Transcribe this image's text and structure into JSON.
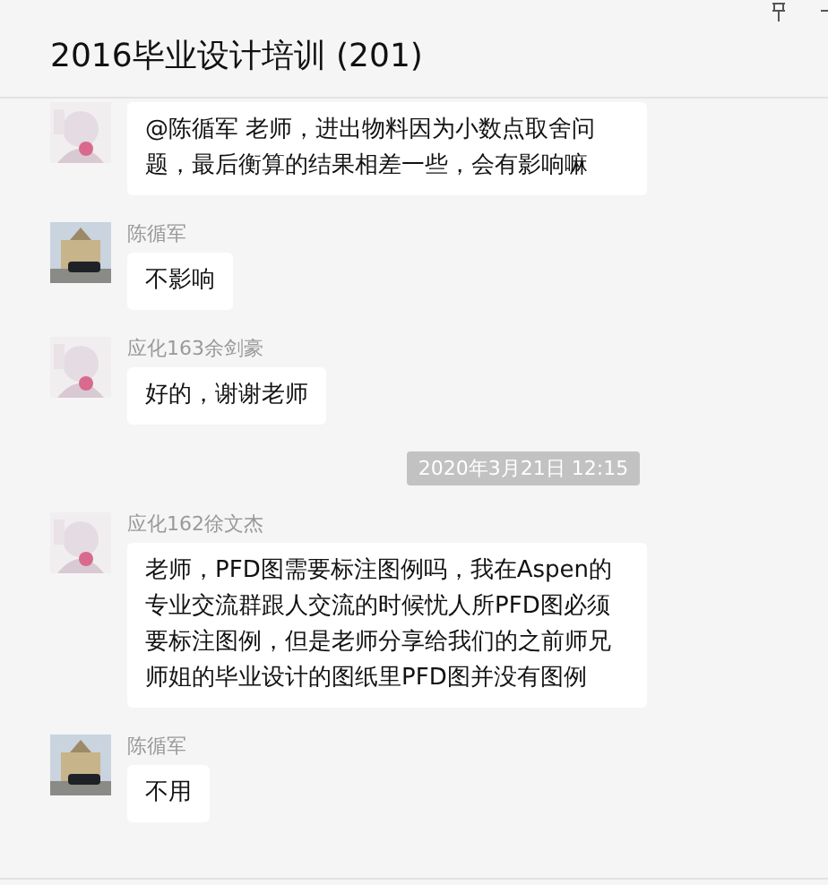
{
  "window": {
    "title": "2016毕业设计培训 (201)"
  },
  "messages": [
    {
      "kind": "message",
      "text": "@陈循军 老师，进出物料因为小数点取舍问题，最后衡算的结果相差一些，会有影响嘛"
    },
    {
      "kind": "message",
      "sender": "陈循军",
      "text": "不影响"
    },
    {
      "kind": "message",
      "sender": "应化163余剑豪",
      "text": "好的，谢谢老师"
    },
    {
      "kind": "time",
      "text": "2020年3月21日 12:15"
    },
    {
      "kind": "message",
      "sender": "应化162徐文杰",
      "text": "老师，PFD图需要标注图例吗，我在Aspen的专业交流群跟人交流的时候忧人所PFD图必须要标注图例，但是老师分享给我们的之前师兄师姐的毕业设计的图纸里PFD图并没有图例"
    },
    {
      "kind": "message",
      "sender": "陈循军",
      "text": "不用"
    }
  ]
}
